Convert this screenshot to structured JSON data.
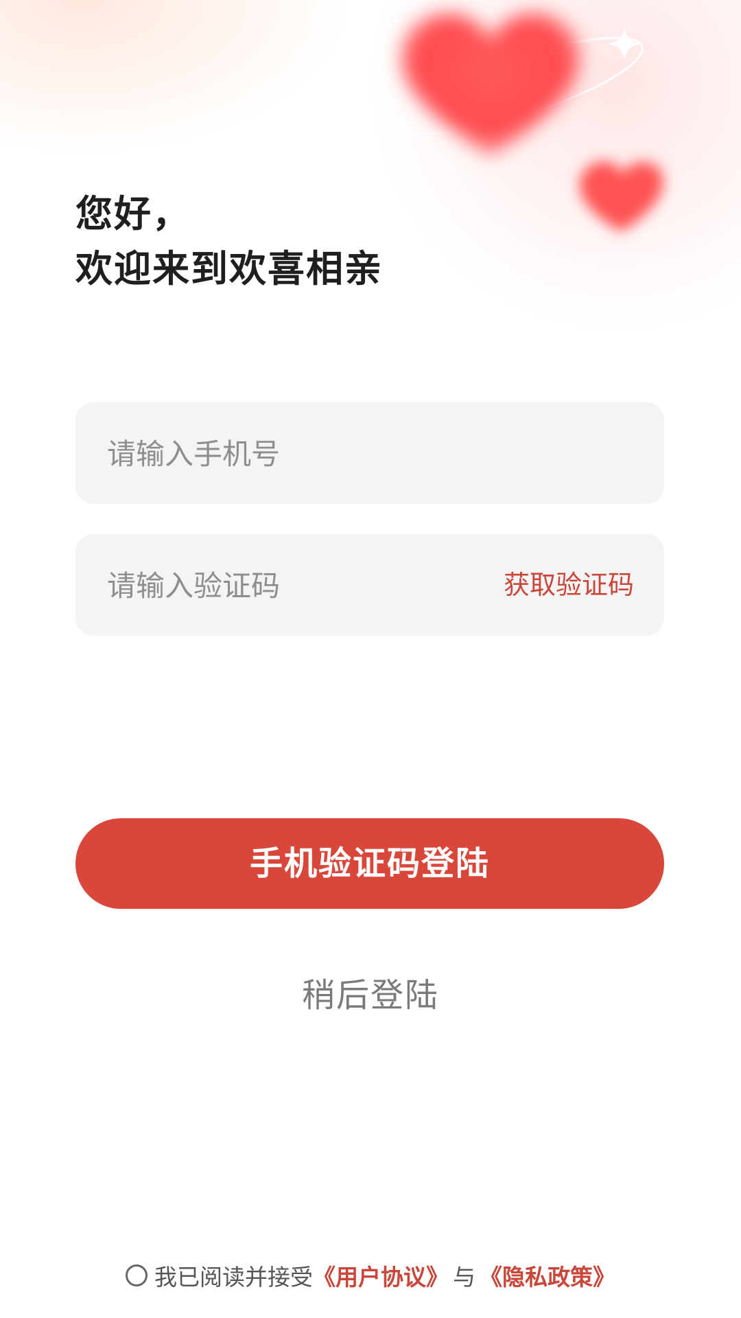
{
  "greeting": {
    "line1": "您好，",
    "line2": "欢迎来到欢喜相亲"
  },
  "phone_field": {
    "placeholder": "请输入手机号",
    "value": ""
  },
  "code_field": {
    "placeholder": "请输入验证码",
    "value": "",
    "get_code_label": "获取验证码"
  },
  "login_button": {
    "label": "手机验证码登陆"
  },
  "later_link": {
    "label": "稍后登陆"
  },
  "agreement": {
    "checked": false,
    "prefix": "我已阅读并接受",
    "user_agreement": "《用户协议》",
    "conjunction": "与",
    "privacy_policy": "《隐私政策》"
  },
  "colors": {
    "accent": "#d9473b",
    "link": "#c8463a",
    "field_bg": "#f4f4f4",
    "heart": "#ff4d4f"
  },
  "decorations": {
    "icons": [
      "heart-icon",
      "small-heart-icon",
      "sparkle-icon"
    ]
  }
}
